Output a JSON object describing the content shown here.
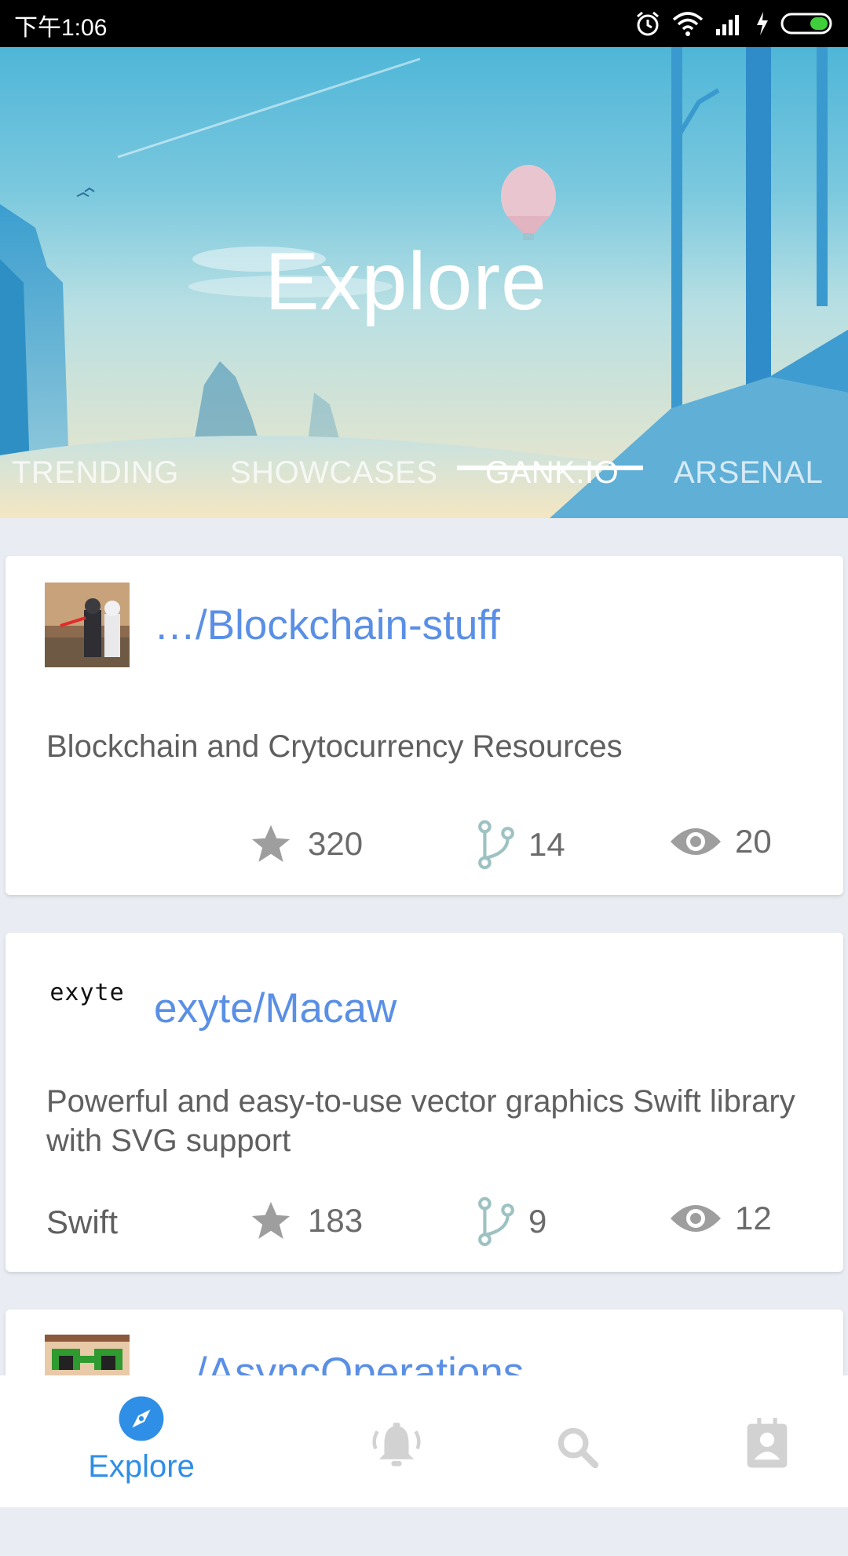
{
  "status_bar": {
    "time": "下午1:06"
  },
  "header": {
    "title": "Explore",
    "tabs": [
      {
        "label": "TRENDING"
      },
      {
        "label": "SHOWCASES"
      },
      {
        "label": "GANK.IO",
        "active": true
      },
      {
        "label": "ARSENAL"
      }
    ]
  },
  "repos": [
    {
      "name": "…/Blockchain-stuff",
      "description": "Blockchain and Crytocurrency Resources",
      "language": "",
      "stars": "320",
      "forks": "14",
      "watchers": "20",
      "avatar_icon": "lego-figures-avatar"
    },
    {
      "name": "exyte/Macaw",
      "avatar_text": "exyte",
      "description": "Powerful and easy-to-use vector graphics Swift library with SVG support",
      "language": "Swift",
      "stars": "183",
      "forks": "9",
      "watchers": "12"
    },
    {
      "name": "…/AsyncOperations",
      "avatar_icon": "pixel-face-avatar"
    }
  ],
  "bottom_nav": {
    "items": [
      {
        "label": "Explore",
        "icon": "compass-icon",
        "active": true
      },
      {
        "label": "",
        "icon": "bell-icon"
      },
      {
        "label": "",
        "icon": "search-icon"
      },
      {
        "label": "",
        "icon": "contact-icon"
      }
    ]
  },
  "colors": {
    "accent": "#2f8ee6",
    "repo_link": "#5a8fe6",
    "background": "#e9ecf2"
  }
}
